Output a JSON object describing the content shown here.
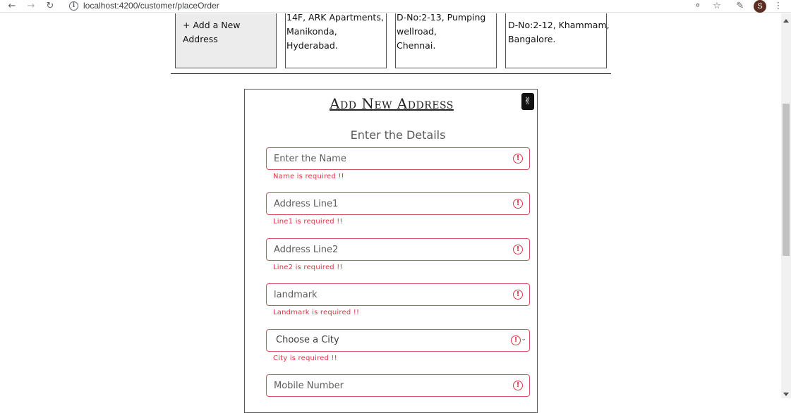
{
  "browser": {
    "url": "localhost:4200/customer/placeOrder",
    "avatar_letter": "S",
    "icons": [
      "back-arrow-icon",
      "forward-arrow-icon",
      "reload-icon",
      "site-info-icon",
      "key-icon",
      "star-icon",
      "extensions-icon",
      "menu-dots-icon"
    ]
  },
  "addresses": {
    "add_label": "+ Add a New Address",
    "cards": [
      {
        "line1": "14F, ARK Apartments,",
        "line2": "Manikonda,",
        "line3": "Hyderabad."
      },
      {
        "line1": "D-No:2-13, Pumping",
        "line2": "wellroad,",
        "line3": "Chennai."
      },
      {
        "line1": "D-No:2-12, Khammam,",
        "line2": "Bangalore."
      }
    ]
  },
  "modal": {
    "title": "Add New Address",
    "subtitle": "Enter the Details",
    "fields": {
      "name": {
        "placeholder": "Enter the Name",
        "error": "Name is required !!"
      },
      "line1": {
        "placeholder": "Address Line1",
        "error": "Line1 is required !!"
      },
      "line2": {
        "placeholder": "Address Line2",
        "error": "Line2 is required !!"
      },
      "landmark": {
        "placeholder": "landmark",
        "error": "Landmark is required !!"
      },
      "city": {
        "selected": "Choose a City",
        "error": "City is required !!"
      },
      "mobile": {
        "placeholder": "Mobile Number"
      }
    }
  },
  "colors": {
    "error": "#dc3545",
    "field_border": "#d9545e",
    "close_button": "#111111"
  }
}
